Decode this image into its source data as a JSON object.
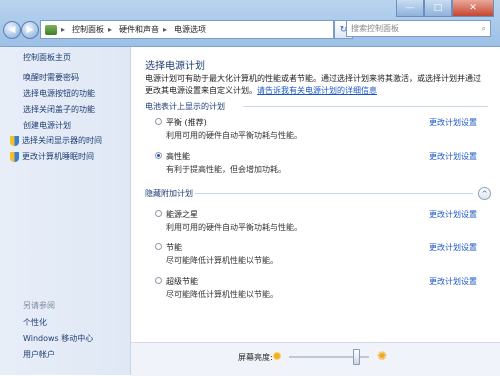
{
  "toolbar": {
    "breadcrumbs": [
      "控制面板",
      "硬件和声音",
      "电源选项"
    ],
    "search_placeholder": "搜索控制面板",
    "controls": {
      "minimize": "—",
      "maximize": "□",
      "close": "✕"
    },
    "back": "◀",
    "forward": "▶",
    "refresh": "↻"
  },
  "sidebar": {
    "home": "控制面板主页",
    "items": [
      "唤醒时需要密码",
      "选择电源按钮的功能",
      "选择关闭盖子的功能",
      "创建电源计划"
    ],
    "icon_items": [
      "选择关闭显示器的时间",
      "更改计算机睡眠时间"
    ],
    "see_also_title": "另请参阅",
    "see_also": [
      "个性化",
      "Windows 移动中心",
      "用户帐户"
    ]
  },
  "main": {
    "title": "选择电源计划",
    "description": "电源计划可有助于最大化计算机的性能或者节能。通过选择计划来将其激活，或选择计划并通过更改其电源设置来自定义计划。",
    "description_link": "请告诉我有关电源计划的详细信息",
    "section1_title": "电池表计上显示的计划",
    "section2_title": "隐藏附加计划",
    "change_label": "更改计划设置",
    "plans_shown": [
      {
        "name": "平衡 (推荐)",
        "desc": "利用可用的硬件自动平衡功耗与性能。",
        "selected": false
      },
      {
        "name": "高性能",
        "desc": "有利于提高性能，但会增加功耗。",
        "selected": true
      }
    ],
    "plans_hidden": [
      {
        "name": "能源之星",
        "desc": "利用可用的硬件自动平衡功耗与性能。",
        "selected": false
      },
      {
        "name": "节能",
        "desc": "尽可能降低计算机性能以节能。",
        "selected": false
      },
      {
        "name": "超级节能",
        "desc": "尽可能降低计算机性能以节能。",
        "selected": false
      }
    ],
    "collapse_icon": "^"
  },
  "bottom": {
    "brightness_label": "屏幕亮度:",
    "brightness_level": 0.83,
    "icons": [
      "sun-small-icon",
      "sun-large-icon"
    ]
  },
  "colors": {
    "link": "#1a56c8",
    "heading": "#1e3d73",
    "sidebar_bg": "#e3ebf6"
  }
}
